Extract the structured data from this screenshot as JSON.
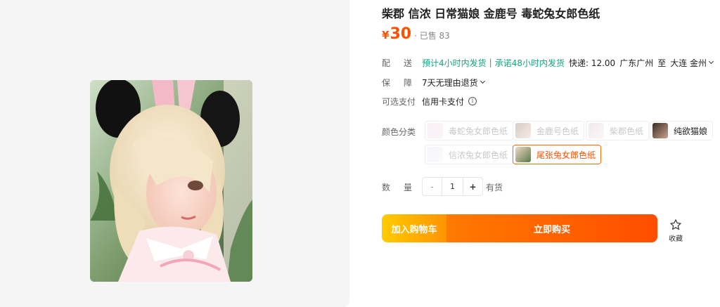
{
  "product": {
    "title": "柴郡 信浓 日常猫娘 金鹿号 毒蛇兔女郎色纸",
    "price_symbol": "¥",
    "price": "30",
    "sold": "· 已售 83"
  },
  "delivery": {
    "label_a": "配",
    "label_b": "送",
    "promise_1": "预计4小时内发货",
    "separator": "|",
    "promise_2": "承诺48小时内发货",
    "shipping": "快递: 12.00",
    "origin": "广东广州",
    "to": "至",
    "destination": "大连 金州"
  },
  "guarantee": {
    "label_a": "保",
    "label_b": "障",
    "value": "7天无理由退货"
  },
  "payment": {
    "label": "可选支付",
    "value": "信用卡支付",
    "info_glyph": "i"
  },
  "colors": {
    "label": "颜色分类",
    "options": [
      {
        "label": "毒蛇兔女郎色纸",
        "state": "disabled"
      },
      {
        "label": "金鹿号色纸",
        "state": "disabled"
      },
      {
        "label": "柴郡色纸",
        "state": "disabled"
      },
      {
        "label": "纯欲猫娘",
        "state": "available"
      },
      {
        "label": "信浓兔女郎色纸",
        "state": "disabled"
      },
      {
        "label": "尾张兔女郎色纸",
        "state": "selected"
      }
    ]
  },
  "quantity": {
    "label_a": "数",
    "label_b": "量",
    "minus": "-",
    "value": "1",
    "plus": "+",
    "stock": "有货"
  },
  "actions": {
    "cart": "加入购物车",
    "buy": "立即购买",
    "favorite": "收藏"
  },
  "theme": {
    "accent": "#ff5000",
    "green": "#16a37f"
  }
}
